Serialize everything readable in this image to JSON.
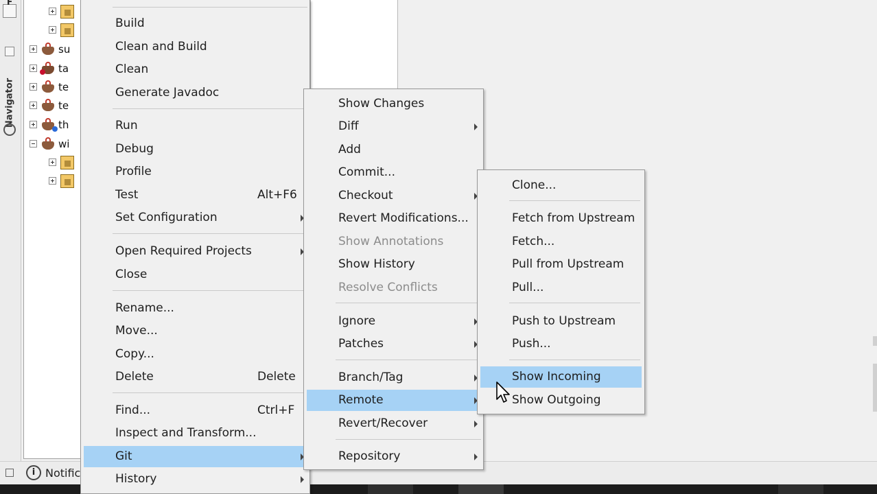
{
  "sidebar": {
    "navigator_label": "Navigator",
    "top_tab_letter": "F"
  },
  "tree": {
    "items": [
      {
        "label": ""
      },
      {
        "label": ""
      },
      {
        "label": "su"
      },
      {
        "label": "ta"
      },
      {
        "label": "te"
      },
      {
        "label": "te"
      },
      {
        "label": "th"
      },
      {
        "label": "wi"
      },
      {
        "label": ""
      },
      {
        "label": ""
      }
    ]
  },
  "bottom": {
    "notifications_label": "Notific"
  },
  "context_menu": {
    "items": [
      {
        "label": "Build"
      },
      {
        "label": "Clean and Build"
      },
      {
        "label": "Clean"
      },
      {
        "label": "Generate Javadoc"
      },
      {
        "label": "Run"
      },
      {
        "label": "Debug"
      },
      {
        "label": "Profile"
      },
      {
        "label": "Test",
        "shortcut": "Alt+F6"
      },
      {
        "label": "Set Configuration"
      },
      {
        "label": "Open Required Projects"
      },
      {
        "label": "Close"
      },
      {
        "label": "Rename..."
      },
      {
        "label": "Move..."
      },
      {
        "label": "Copy..."
      },
      {
        "label": "Delete",
        "shortcut": "Delete"
      },
      {
        "label": "Find...",
        "shortcut": "Ctrl+F"
      },
      {
        "label": "Inspect and Transform..."
      },
      {
        "label": "Git"
      },
      {
        "label": "History"
      }
    ]
  },
  "git_menu": {
    "items": [
      {
        "label": "Show Changes"
      },
      {
        "label": "Diff"
      },
      {
        "label": "Add"
      },
      {
        "label": "Commit..."
      },
      {
        "label": "Checkout"
      },
      {
        "label": "Revert Modifications..."
      },
      {
        "label": "Show Annotations"
      },
      {
        "label": "Show History"
      },
      {
        "label": "Resolve Conflicts"
      },
      {
        "label": "Ignore"
      },
      {
        "label": "Patches"
      },
      {
        "label": "Branch/Tag"
      },
      {
        "label": "Remote"
      },
      {
        "label": "Revert/Recover"
      },
      {
        "label": "Repository"
      }
    ]
  },
  "remote_menu": {
    "items": [
      {
        "label": "Clone..."
      },
      {
        "label": "Fetch from Upstream"
      },
      {
        "label": "Fetch..."
      },
      {
        "label": "Pull from Upstream"
      },
      {
        "label": "Pull..."
      },
      {
        "label": "Push to Upstream"
      },
      {
        "label": "Push..."
      },
      {
        "label": "Show Incoming"
      },
      {
        "label": "Show Outgoing"
      }
    ]
  },
  "colors": {
    "highlight": "#a6d2f5",
    "disabled_text": "#8c8c8c",
    "menu_bg": "#f0f0f0"
  }
}
